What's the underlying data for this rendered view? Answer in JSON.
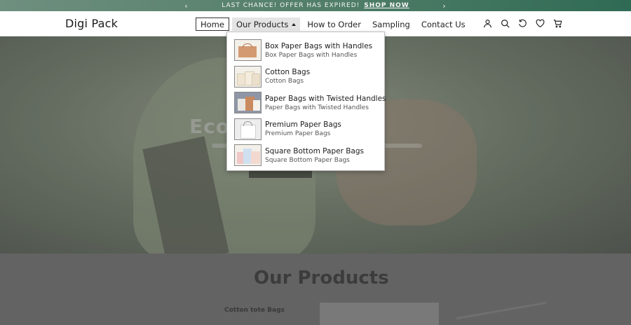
{
  "announcement": {
    "message": "LAST CHANCE!  OFFER HAS EXPIRED!",
    "link": "SHOP NOW"
  },
  "header": {
    "logo": "Digi Pack",
    "nav": [
      {
        "label": "Home"
      },
      {
        "label": "Our Products"
      },
      {
        "label": "How to Order"
      },
      {
        "label": "Sampling"
      },
      {
        "label": "Contact Us"
      }
    ]
  },
  "dropdown": {
    "items": [
      {
        "title": "Box Paper Bags with Handles",
        "subtitle": "Box Paper Bags with Handles"
      },
      {
        "title": "Cotton Bags",
        "subtitle": "Cotton Bags"
      },
      {
        "title": "Paper Bags with Twisted Handles",
        "subtitle": "Paper Bags with Twisted Handles"
      },
      {
        "title": "Premium Paper Bags",
        "subtitle": "Premium Paper Bags"
      },
      {
        "title": "Square Bottom Paper Bags",
        "subtitle": "Square Bottom Paper Bags"
      }
    ]
  },
  "hero": {
    "title": "Eco                  n Bags"
  },
  "section": {
    "heading": "Our Products",
    "card_label": "Cotton tote Bags"
  },
  "icons": [
    "account-icon",
    "search-icon",
    "recently-viewed-icon",
    "wishlist-heart-icon",
    "cart-icon"
  ],
  "colors": {
    "announcement_bg": "#4f7d67",
    "nav_active_bg": "#e4e4e4"
  }
}
